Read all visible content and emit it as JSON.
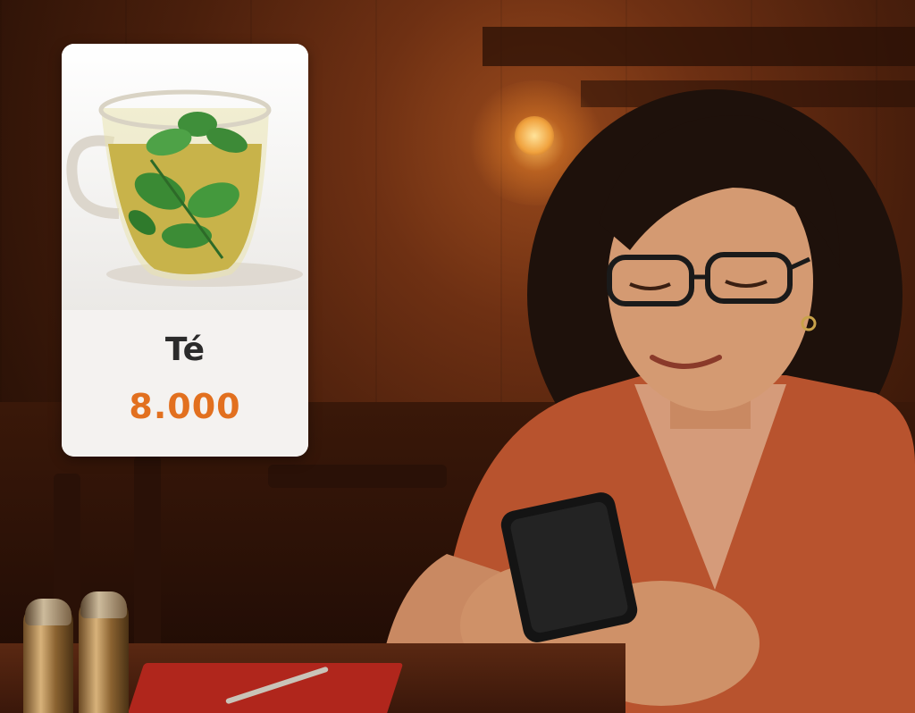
{
  "menu_card": {
    "item_name": "Té",
    "item_price": "8.000",
    "image_icon": "mint-tea-glass-icon",
    "price_color": "#e2701f"
  },
  "scene": {
    "subject": "woman-using-smartphone",
    "setting": "restaurant-table"
  }
}
